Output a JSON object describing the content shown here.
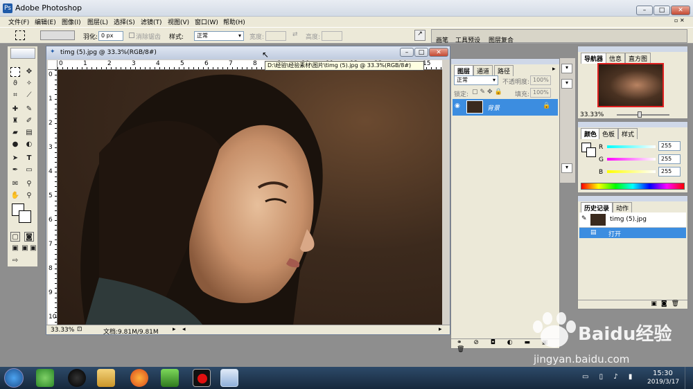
{
  "app": {
    "title": "Adobe Photoshop"
  },
  "menu": [
    "文件(F)",
    "编辑(E)",
    "图像(I)",
    "图层(L)",
    "选择(S)",
    "滤镜(T)",
    "视图(V)",
    "窗口(W)",
    "帮助(H)"
  ],
  "options": {
    "feather_label": "羽化:",
    "feather_value": "0 px",
    "antialias": "消除锯齿",
    "style_label": "样式:",
    "style_value": "正常",
    "width_label": "宽度:",
    "height_label": "高度:",
    "right_tabs": [
      "画笔",
      "工具预设",
      "图层复合"
    ]
  },
  "document": {
    "title": "timg (5).jpg @ 33.3%(RGB/8#)",
    "zoom": "33.33%",
    "doc_size": "文档:9.81M/9.81M",
    "tooltip": "D:\\经验\\经验素材\\图片\\timg (5).jpg @ 33.3%(RGB/8#)",
    "ruler_h": [
      "0",
      "1",
      "2",
      "3",
      "4",
      "5",
      "6",
      "7",
      "8",
      "9",
      "10",
      "11",
      "12",
      "13",
      "14",
      "15"
    ],
    "ruler_v": [
      "0",
      "1",
      "2",
      "3",
      "4",
      "5",
      "6",
      "7",
      "8",
      "9",
      "10",
      "11",
      "12"
    ]
  },
  "layers": {
    "tabs": [
      "图层",
      "通道",
      "路径"
    ],
    "blend": "正常",
    "opacity_label": "不透明度:",
    "opacity": "100%",
    "lock_label": "锁定:",
    "fill_label": "填充:",
    "fill": "100%",
    "layer_name": "背景"
  },
  "navigator": {
    "tabs": [
      "导航器",
      "信息",
      "直方图"
    ],
    "zoom": "33.33%"
  },
  "color": {
    "tabs": [
      "颜色",
      "色板",
      "样式"
    ],
    "r_label": "R",
    "g_label": "G",
    "b_label": "B",
    "r": "255",
    "g": "255",
    "b": "255"
  },
  "history": {
    "tabs": [
      "历史记录",
      "动作"
    ],
    "snapshot": "timg (5).jpg",
    "step": "打开"
  },
  "taskbar": {
    "time": "15:30",
    "date": "2019/3/17"
  },
  "watermark": {
    "brand": "Baidu经验",
    "url": "jingyan.baidu.com"
  }
}
